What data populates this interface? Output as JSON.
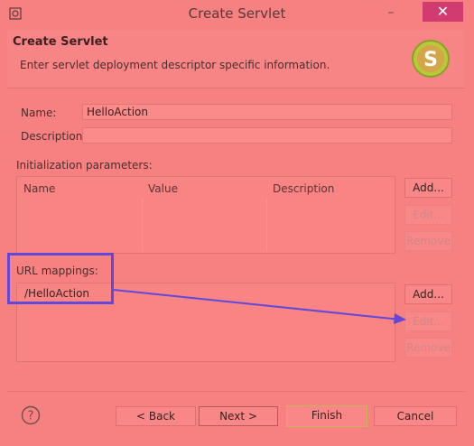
{
  "window": {
    "title": "Create Servlet",
    "minimize_glyph": "–",
    "close_glyph": "✕"
  },
  "header": {
    "title": "Create Servlet",
    "description": "Enter servlet deployment descriptor specific information.",
    "logo_letter": "S"
  },
  "form": {
    "name_label": "Name:",
    "name_value": "HelloAction",
    "description_label": "Description:",
    "description_value": ""
  },
  "init_params": {
    "label": "Initialization parameters:",
    "columns": [
      "Name",
      "Value",
      "Description"
    ],
    "add": "Add...",
    "edit": "Edit...",
    "remove": "Remove"
  },
  "url_mappings": {
    "label": "URL mappings:",
    "items": [
      "/HelloAction"
    ],
    "add": "Add...",
    "edit": "Edit...",
    "remove": "Remove"
  },
  "footer": {
    "help_glyph": "?",
    "back": "< Back",
    "next": "Next >",
    "finish": "Finish",
    "cancel": "Cancel"
  },
  "colors": {
    "background": "#f78181",
    "annotation": "#6347d8",
    "close": "#d23b6f"
  },
  "icons": [
    "app-icon",
    "servlet-logo-icon",
    "help-icon",
    "annotation-arrow"
  ]
}
